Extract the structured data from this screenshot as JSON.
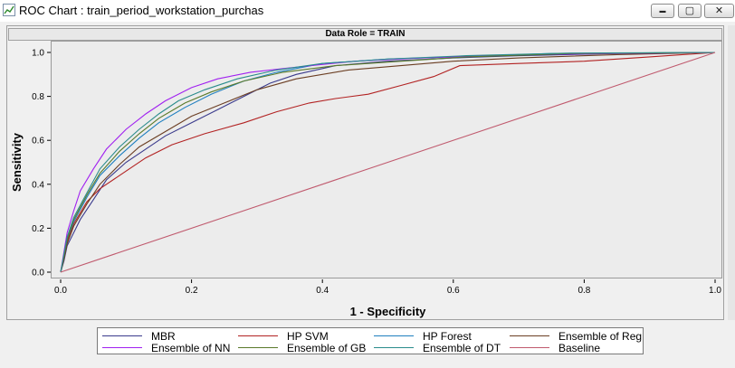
{
  "window": {
    "title": "ROC Chart : train_period_workstation_purchas",
    "minimize_glyph": "▬",
    "maximize_glyph": "▢",
    "close_glyph": "✕",
    "icon": "line-chart-icon"
  },
  "header": {
    "data_role": "Data Role = TRAIN"
  },
  "chart_data": {
    "type": "line",
    "title": "Data Role = TRAIN",
    "xlabel": "1 - Specificity",
    "ylabel": "Sensitivity",
    "xlim": [
      0,
      1
    ],
    "ylim": [
      0,
      1
    ],
    "xticks": [
      "0.0",
      "0.2",
      "0.4",
      "0.6",
      "0.8",
      "1.0"
    ],
    "yticks": [
      "0.0",
      "0.2",
      "0.4",
      "0.6",
      "0.8",
      "1.0"
    ],
    "grid": false,
    "legend_position": "bottom",
    "series": [
      {
        "name": "MBR",
        "color": "#3a3a8c",
        "points": [
          [
            0,
            0
          ],
          [
            0.005,
            0.05
          ],
          [
            0.01,
            0.12
          ],
          [
            0.02,
            0.18
          ],
          [
            0.03,
            0.24
          ],
          [
            0.05,
            0.33
          ],
          [
            0.07,
            0.42
          ],
          [
            0.1,
            0.5
          ],
          [
            0.13,
            0.56
          ],
          [
            0.16,
            0.62
          ],
          [
            0.2,
            0.68
          ],
          [
            0.24,
            0.74
          ],
          [
            0.28,
            0.8
          ],
          [
            0.32,
            0.86
          ],
          [
            0.36,
            0.9
          ],
          [
            0.42,
            0.94
          ],
          [
            0.5,
            0.96
          ],
          [
            0.6,
            0.975
          ],
          [
            0.7,
            0.985
          ],
          [
            0.85,
            0.995
          ],
          [
            1,
            1
          ]
        ]
      },
      {
        "name": "HP SVM",
        "color": "#b22222",
        "points": [
          [
            0,
            0
          ],
          [
            0.005,
            0.06
          ],
          [
            0.01,
            0.14
          ],
          [
            0.02,
            0.22
          ],
          [
            0.04,
            0.32
          ],
          [
            0.06,
            0.38
          ],
          [
            0.1,
            0.46
          ],
          [
            0.13,
            0.52
          ],
          [
            0.17,
            0.58
          ],
          [
            0.22,
            0.63
          ],
          [
            0.28,
            0.68
          ],
          [
            0.33,
            0.73
          ],
          [
            0.38,
            0.77
          ],
          [
            0.42,
            0.79
          ],
          [
            0.47,
            0.81
          ],
          [
            0.52,
            0.85
          ],
          [
            0.57,
            0.89
          ],
          [
            0.61,
            0.94
          ],
          [
            0.7,
            0.95
          ],
          [
            0.8,
            0.96
          ],
          [
            0.9,
            0.98
          ],
          [
            1,
            1
          ]
        ]
      },
      {
        "name": "HP Forest",
        "color": "#1f7fbf",
        "points": [
          [
            0,
            0
          ],
          [
            0.005,
            0.07
          ],
          [
            0.01,
            0.15
          ],
          [
            0.02,
            0.23
          ],
          [
            0.04,
            0.34
          ],
          [
            0.06,
            0.44
          ],
          [
            0.09,
            0.53
          ],
          [
            0.12,
            0.61
          ],
          [
            0.15,
            0.68
          ],
          [
            0.19,
            0.75
          ],
          [
            0.23,
            0.81
          ],
          [
            0.28,
            0.87
          ],
          [
            0.33,
            0.91
          ],
          [
            0.4,
            0.95
          ],
          [
            0.5,
            0.97
          ],
          [
            0.6,
            0.98
          ],
          [
            0.75,
            0.995
          ],
          [
            1,
            1
          ]
        ]
      },
      {
        "name": "Ensemble of Reg",
        "color": "#6b3e23",
        "points": [
          [
            0,
            0
          ],
          [
            0.005,
            0.06
          ],
          [
            0.01,
            0.13
          ],
          [
            0.02,
            0.21
          ],
          [
            0.04,
            0.31
          ],
          [
            0.06,
            0.4
          ],
          [
            0.09,
            0.49
          ],
          [
            0.12,
            0.57
          ],
          [
            0.16,
            0.64
          ],
          [
            0.2,
            0.71
          ],
          [
            0.25,
            0.77
          ],
          [
            0.3,
            0.83
          ],
          [
            0.36,
            0.88
          ],
          [
            0.44,
            0.92
          ],
          [
            0.52,
            0.94
          ],
          [
            0.6,
            0.96
          ],
          [
            0.7,
            0.975
          ],
          [
            0.85,
            0.99
          ],
          [
            1,
            1
          ]
        ]
      },
      {
        "name": "Ensemble of NN",
        "color": "#a020f0",
        "points": [
          [
            0,
            0
          ],
          [
            0.005,
            0.09
          ],
          [
            0.01,
            0.18
          ],
          [
            0.02,
            0.28
          ],
          [
            0.03,
            0.37
          ],
          [
            0.05,
            0.47
          ],
          [
            0.07,
            0.56
          ],
          [
            0.1,
            0.65
          ],
          [
            0.13,
            0.72
          ],
          [
            0.16,
            0.78
          ],
          [
            0.2,
            0.84
          ],
          [
            0.24,
            0.88
          ],
          [
            0.29,
            0.91
          ],
          [
            0.35,
            0.93
          ],
          [
            0.45,
            0.96
          ],
          [
            0.55,
            0.975
          ],
          [
            0.7,
            0.99
          ],
          [
            1,
            1
          ]
        ]
      },
      {
        "name": "Ensemble of GB",
        "color": "#5a7a2a",
        "points": [
          [
            0,
            0
          ],
          [
            0.005,
            0.07
          ],
          [
            0.01,
            0.15
          ],
          [
            0.02,
            0.24
          ],
          [
            0.04,
            0.35
          ],
          [
            0.06,
            0.45
          ],
          [
            0.09,
            0.55
          ],
          [
            0.12,
            0.63
          ],
          [
            0.15,
            0.7
          ],
          [
            0.19,
            0.77
          ],
          [
            0.23,
            0.82
          ],
          [
            0.28,
            0.87
          ],
          [
            0.34,
            0.91
          ],
          [
            0.42,
            0.94
          ],
          [
            0.52,
            0.96
          ],
          [
            0.62,
            0.98
          ],
          [
            0.78,
            0.995
          ],
          [
            1,
            1
          ]
        ]
      },
      {
        "name": "Ensemble of DT",
        "color": "#2a8c8c",
        "points": [
          [
            0,
            0
          ],
          [
            0.005,
            0.08
          ],
          [
            0.01,
            0.16
          ],
          [
            0.02,
            0.25
          ],
          [
            0.04,
            0.36
          ],
          [
            0.06,
            0.47
          ],
          [
            0.09,
            0.57
          ],
          [
            0.12,
            0.65
          ],
          [
            0.15,
            0.72
          ],
          [
            0.18,
            0.78
          ],
          [
            0.22,
            0.83
          ],
          [
            0.27,
            0.88
          ],
          [
            0.33,
            0.92
          ],
          [
            0.4,
            0.95
          ],
          [
            0.5,
            0.97
          ],
          [
            0.62,
            0.985
          ],
          [
            0.78,
            0.997
          ],
          [
            1,
            1
          ]
        ]
      },
      {
        "name": "Baseline",
        "color": "#c05a6e",
        "points": [
          [
            0,
            0
          ],
          [
            1,
            1
          ]
        ]
      }
    ]
  }
}
